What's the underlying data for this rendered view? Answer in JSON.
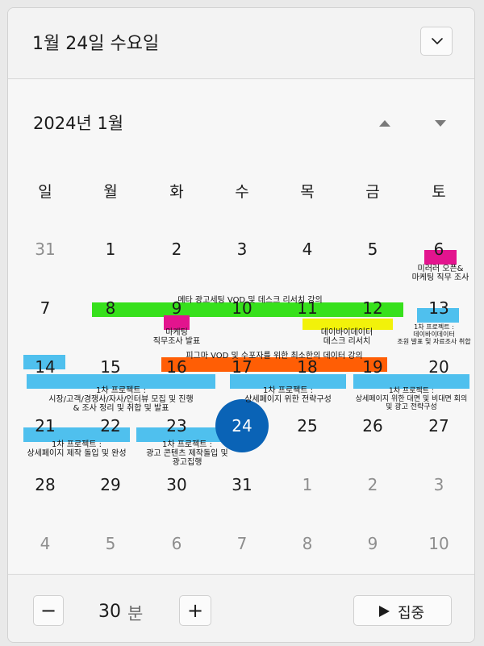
{
  "header": {
    "date_title": "1월 24일 수요일"
  },
  "calendar": {
    "month_title": "2024년 1월",
    "weekdays": [
      "일",
      "월",
      "화",
      "수",
      "목",
      "금",
      "토"
    ],
    "weeks": [
      [
        "31",
        "1",
        "2",
        "3",
        "4",
        "5",
        "6"
      ],
      [
        "7",
        "8",
        "9",
        "10",
        "11",
        "12",
        "13"
      ],
      [
        "14",
        "15",
        "16",
        "17",
        "18",
        "19",
        "20"
      ],
      [
        "21",
        "22",
        "23",
        "24",
        "25",
        "26",
        "27"
      ],
      [
        "28",
        "29",
        "30",
        "31",
        "1",
        "2",
        "3"
      ],
      [
        "4",
        "5",
        "6",
        "7",
        "8",
        "9",
        "10"
      ]
    ],
    "today": "24"
  },
  "events": {
    "mirror_open": [
      "미러러 오픈&",
      "마케팅 직무 조사"
    ],
    "meta_ad_vod": [
      "메타 광고세팅 VOD 및 데스크 리서치 강의"
    ],
    "marketing_presentation": [
      "마케팅",
      "직무조사 발표"
    ],
    "data_desk_research": [
      "데이바이데이터",
      "데스크 리서치"
    ],
    "project1_presentation": [
      "1차 프로젝트 :",
      "데이바이데이터",
      "조원 발표 및 자료조사 취합"
    ],
    "pikma_vod": [
      "피그마 VOD 및 수포자를 위한 최소한의 데이터 강의"
    ],
    "project1_market": [
      "1차 프로젝트 :",
      "시장/고객/경쟁사/자사/인터뷰 모집 및 진행",
      "& 조사 정리 및 취합 및 발표"
    ],
    "project1_detail_strategy": [
      "1차 프로젝트 :",
      "상세페이지 위한 전략구성"
    ],
    "project1_meeting": [
      "1차 프로젝트 :",
      "상세페이지 위한 대면 및 비대면 회의",
      "및 광고 전략구성"
    ],
    "project1_detail_make": [
      "1차 프로젝트 :",
      "상세페이지 제작 돌입 및 완성"
    ],
    "project1_ad_content": [
      "1차 프로젝트 :",
      "광고 콘텐츠 제작돌입 및",
      "광고집행"
    ]
  },
  "colors": {
    "magenta": "#e3148e",
    "green": "#37e01c",
    "yellow": "#f2f20a",
    "blue": "#4fc0ee",
    "orange": "#ff5e05",
    "today": "#0a63b6"
  },
  "footer": {
    "minus_label": "−",
    "minutes_value": "30",
    "minutes_unit": "분",
    "plus_label": "+",
    "focus_label": "집중"
  }
}
